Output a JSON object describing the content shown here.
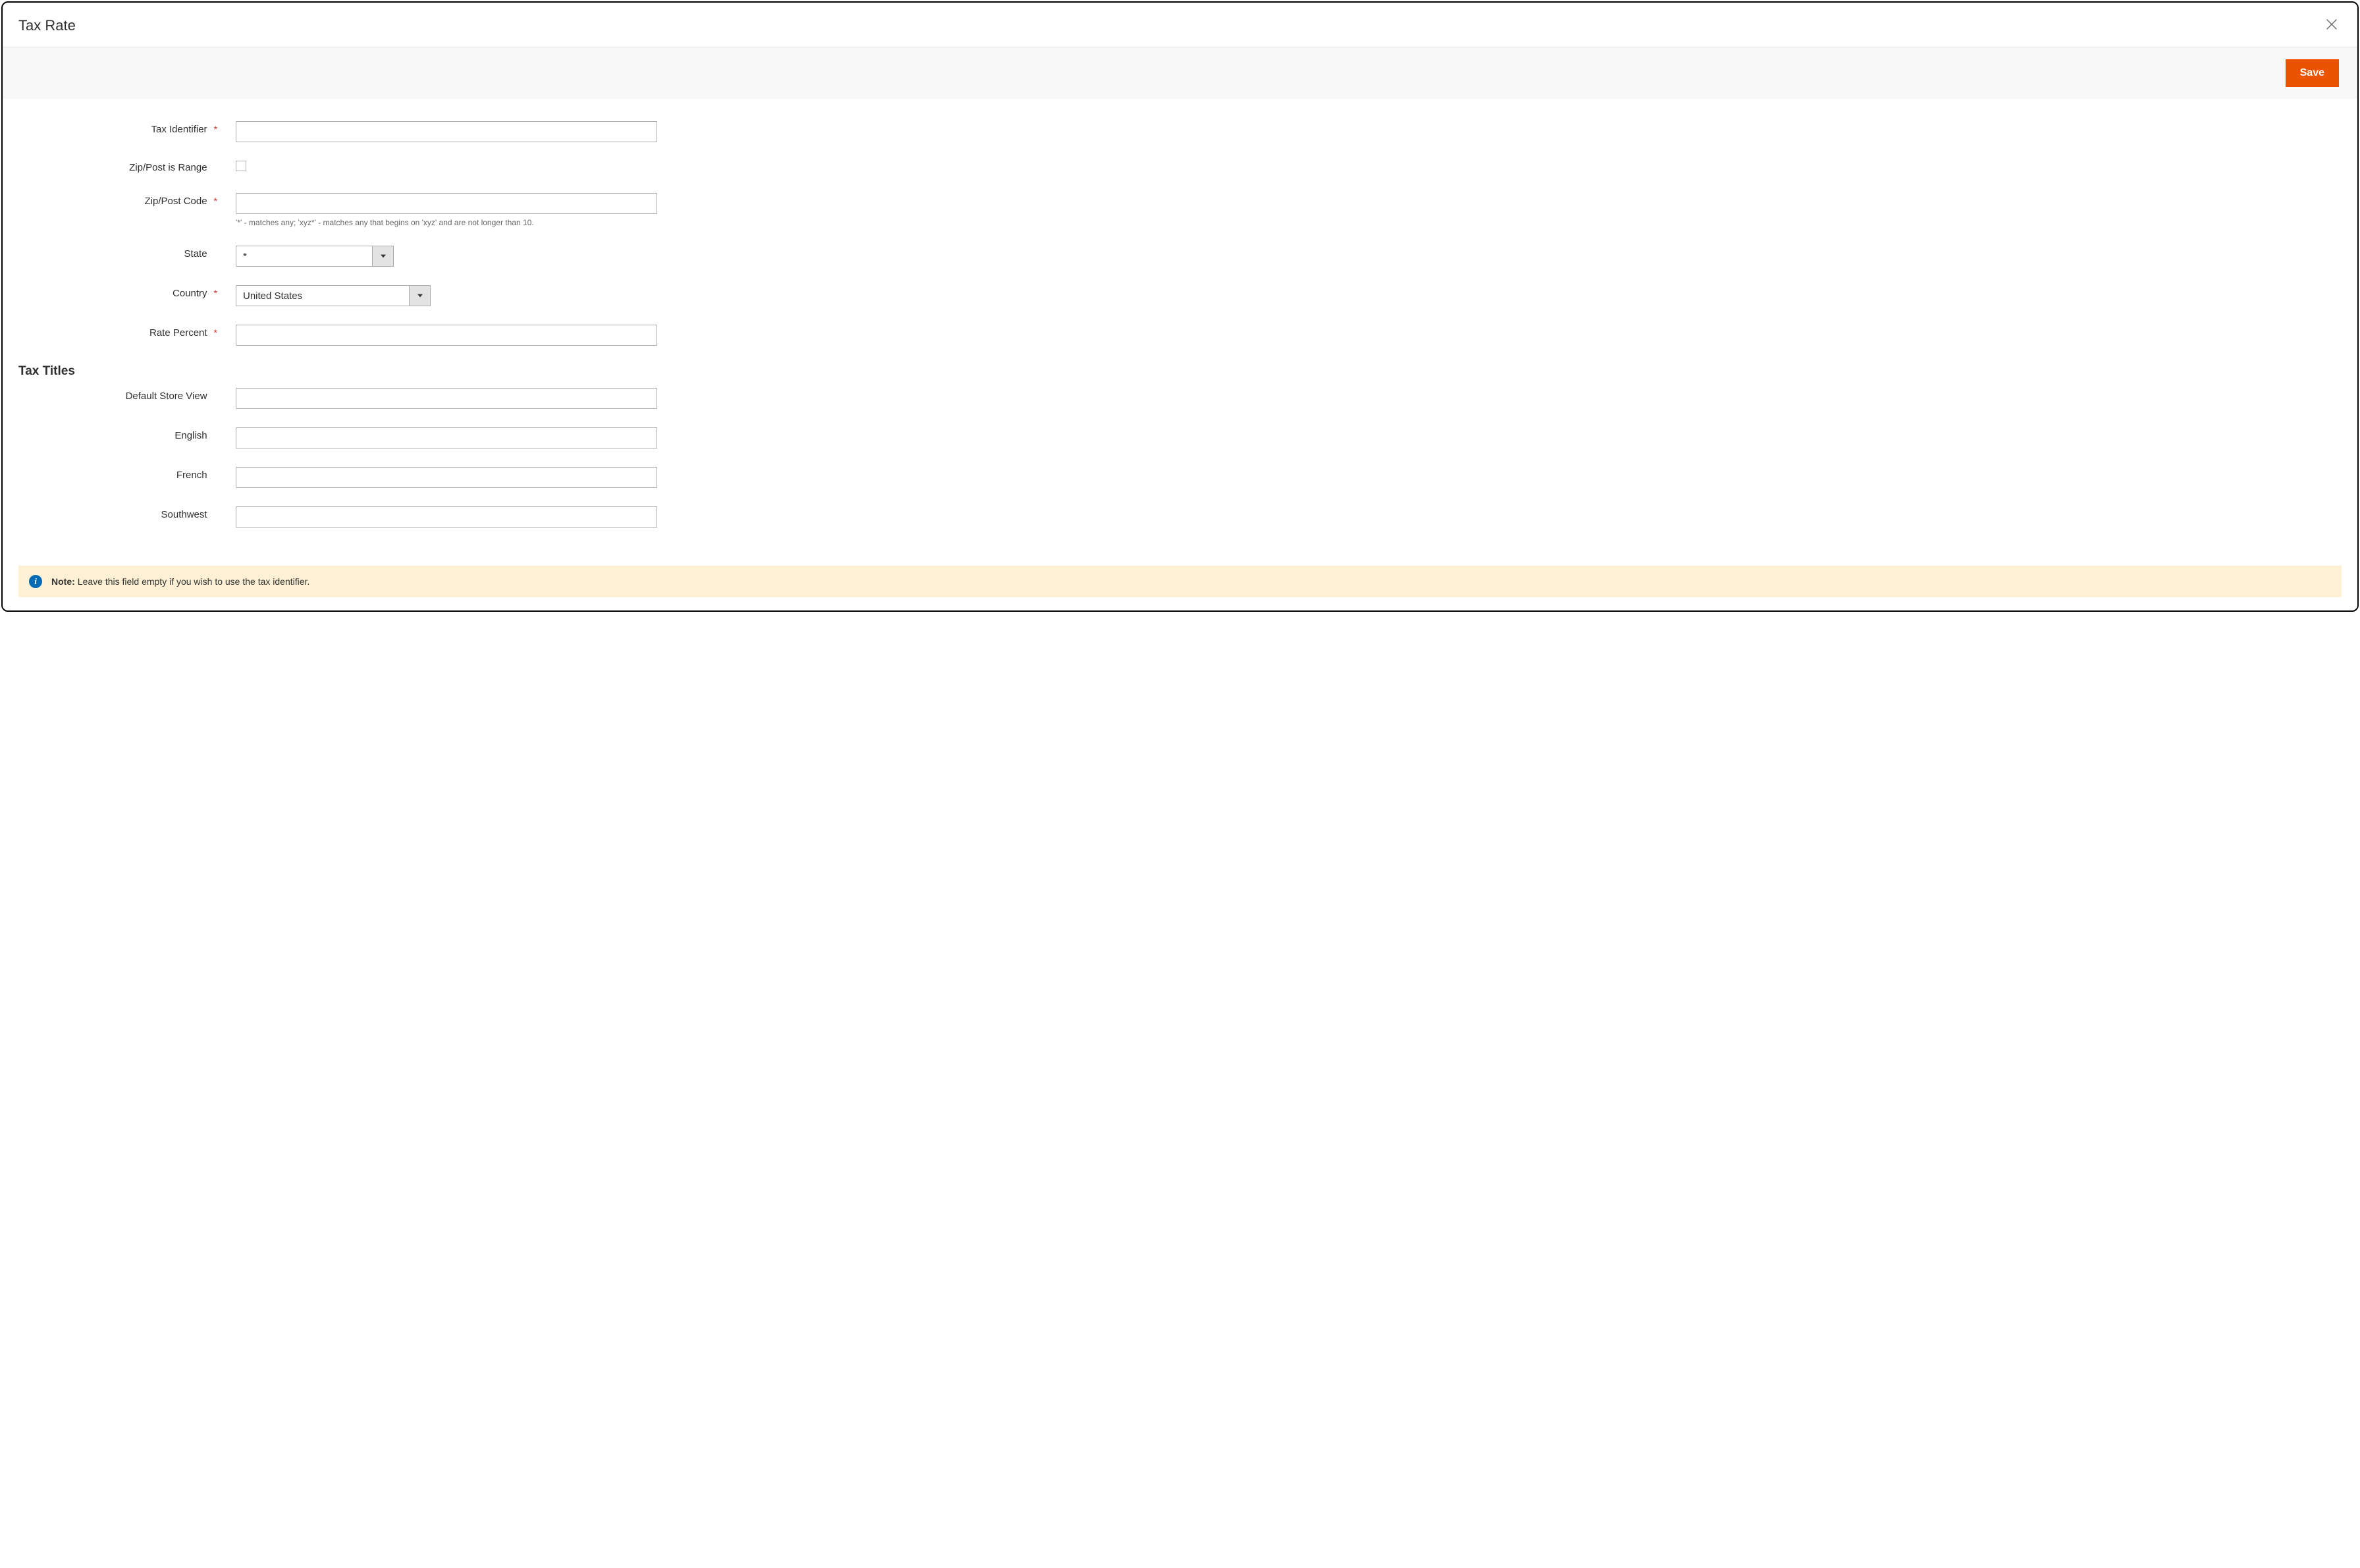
{
  "modal": {
    "title": "Tax Rate",
    "save_label": "Save"
  },
  "form": {
    "tax_identifier": {
      "label": "Tax Identifier",
      "required": true,
      "value": ""
    },
    "zip_is_range": {
      "label": "Zip/Post is Range",
      "required": false,
      "checked": false
    },
    "zip_code": {
      "label": "Zip/Post Code",
      "required": true,
      "value": "",
      "help": "'*' - matches any; 'xyz*' - matches any that begins on 'xyz' and are not longer than 10."
    },
    "state": {
      "label": "State",
      "required": false,
      "value": "*"
    },
    "country": {
      "label": "Country",
      "required": true,
      "value": "United States"
    },
    "rate_percent": {
      "label": "Rate Percent",
      "required": true,
      "value": ""
    }
  },
  "tax_titles": {
    "heading": "Tax Titles",
    "items": [
      {
        "label": "Default Store View",
        "value": ""
      },
      {
        "label": "English",
        "value": ""
      },
      {
        "label": "French",
        "value": ""
      },
      {
        "label": "Southwest",
        "value": ""
      }
    ]
  },
  "note": {
    "prefix": "Note:",
    "text": "Leave this field empty if you wish to use the tax identifier."
  }
}
